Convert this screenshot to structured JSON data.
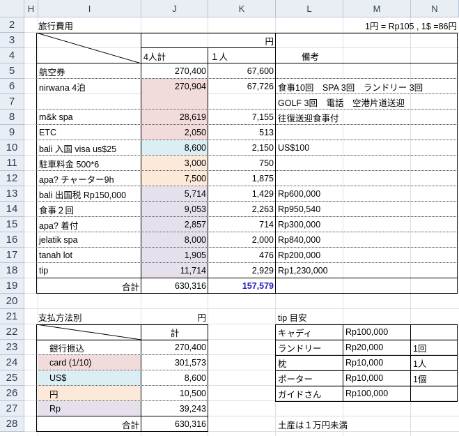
{
  "columns": [
    "H",
    "I",
    "J",
    "K",
    "L",
    "M",
    "N"
  ],
  "rows": [
    "2",
    "3",
    "4",
    "5",
    "6",
    "7",
    "8",
    "9",
    "10",
    "11",
    "12",
    "13",
    "14",
    "15",
    "16",
    "17",
    "18",
    "19",
    "20",
    "21",
    "22",
    "23",
    "24",
    "25",
    "26",
    "27",
    "28"
  ],
  "title": "旅行費用",
  "rate": "1円 = Rp105 , 1$ =86円",
  "unit_yen": "円",
  "head_total4": "4人計",
  "head_per": "１人",
  "head_note": "備考",
  "expenses": [
    {
      "item": "航空券",
      "total": "270,400",
      "per": "67,600",
      "note": ""
    },
    {
      "item": "nirwana 4泊",
      "total": "270,904",
      "per": "67,726",
      "note": "食事10回　SPA 3回　ランドリー 3回"
    },
    {
      "item": "",
      "total": "",
      "per": "",
      "note": "GOLF 3回　電話　空港片道送迎"
    },
    {
      "item": "m&k spa",
      "total": "28,619",
      "per": "7,155",
      "note": "往復送迎食事付"
    },
    {
      "item": "ETC",
      "total": "2,050",
      "per": "513",
      "note": ""
    },
    {
      "item": "bali 入国 visa us$25",
      "total": "8,600",
      "per": "2,150",
      "note": "US$100"
    },
    {
      "item": "駐車料金 500*6",
      "total": "3,000",
      "per": "750",
      "note": ""
    },
    {
      "item": "apa? チャーター9h",
      "total": "7,500",
      "per": "1,875",
      "note": ""
    },
    {
      "item": "bali 出国税 Rp150,000",
      "total": "5,714",
      "per": "1,429",
      "note": "Rp600,000"
    },
    {
      "item": "食事２回",
      "total": "9,053",
      "per": "2,263",
      "note": "Rp950,540"
    },
    {
      "item": "apa? 着付",
      "total": "2,857",
      "per": "714",
      "note": "Rp300,000"
    },
    {
      "item": "jelatik spa",
      "total": "8,000",
      "per": "2,000",
      "note": "Rp840,000"
    },
    {
      "item": "tanah lot",
      "total": "1,905",
      "per": "476",
      "note": "Rp200,000"
    },
    {
      "item": "tip",
      "total": "11,714",
      "per": "2,929",
      "note": "Rp1,230,000"
    }
  ],
  "total_label": "合計",
  "total_all": "630,316",
  "total_per": "157,579",
  "payment": {
    "title": "支払方法別",
    "unit": "円",
    "head": "計",
    "rows": [
      {
        "label": "銀行振込",
        "value": "270,400"
      },
      {
        "label": "card (1/10)",
        "value": "301,573"
      },
      {
        "label": "US$",
        "value": "8,600"
      },
      {
        "label": "円",
        "value": "10,500"
      },
      {
        "label": "Rp",
        "value": "39,243"
      }
    ],
    "total_label": "合計",
    "total": "630,316"
  },
  "tip_guide": {
    "title": "tip 目安",
    "rows": [
      {
        "name": "キャディ",
        "amount": "Rp100,000",
        "unit": ""
      },
      {
        "name": "ランドリー",
        "amount": "Rp20,000",
        "unit": "1回"
      },
      {
        "name": "枕",
        "amount": "Rp10,000",
        "unit": "1人"
      },
      {
        "name": "ポーター",
        "amount": "Rp10,000",
        "unit": "1個"
      },
      {
        "name": "ガイドさん",
        "amount": "Rp100,000",
        "unit": ""
      }
    ]
  },
  "souvenir_note": "土産は１万円未満",
  "colors": {
    "pink": "#f2dcdb",
    "peach": "#fde9d9",
    "blue": "#daeef3",
    "lavender": "#e5e0ec",
    "accent": "#1f1fbf"
  }
}
